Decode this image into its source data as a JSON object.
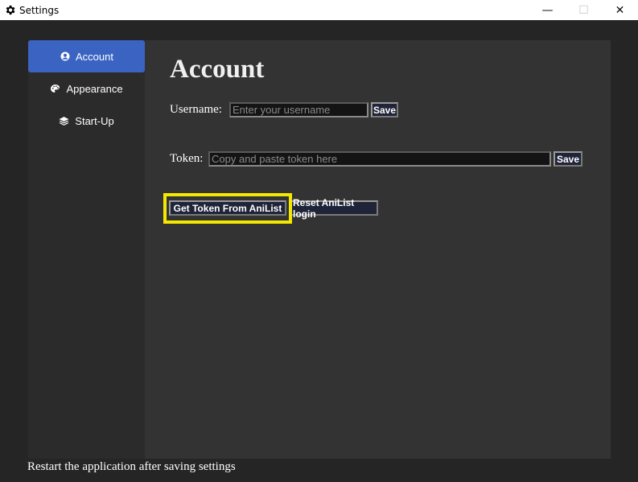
{
  "window": {
    "title": "Settings",
    "icon": "gear-icon",
    "controls": {
      "minimize": "—",
      "maximize": "☐",
      "close": "✕"
    }
  },
  "sidebar": {
    "items": [
      {
        "label": "Account",
        "icon": "user-circle-icon",
        "active": true
      },
      {
        "label": "Appearance",
        "icon": "palette-icon",
        "active": false
      },
      {
        "label": "Start-Up",
        "icon": "layers-icon",
        "active": false
      }
    ]
  },
  "main": {
    "title": "Account",
    "username": {
      "label": "Username:",
      "placeholder": "Enter your username",
      "value": "",
      "save_label": "Save"
    },
    "token": {
      "label": "Token:",
      "placeholder": "Copy and paste token here",
      "value": "",
      "save_label": "Save"
    },
    "get_token_label": "Get Token From AniList",
    "reset_label": "Reset AniList login"
  },
  "footer": {
    "note": "Restart the application after saving settings"
  },
  "colors": {
    "accent": "#3a63c2",
    "highlight": "#f5e800",
    "button_bg": "#1f2438"
  }
}
